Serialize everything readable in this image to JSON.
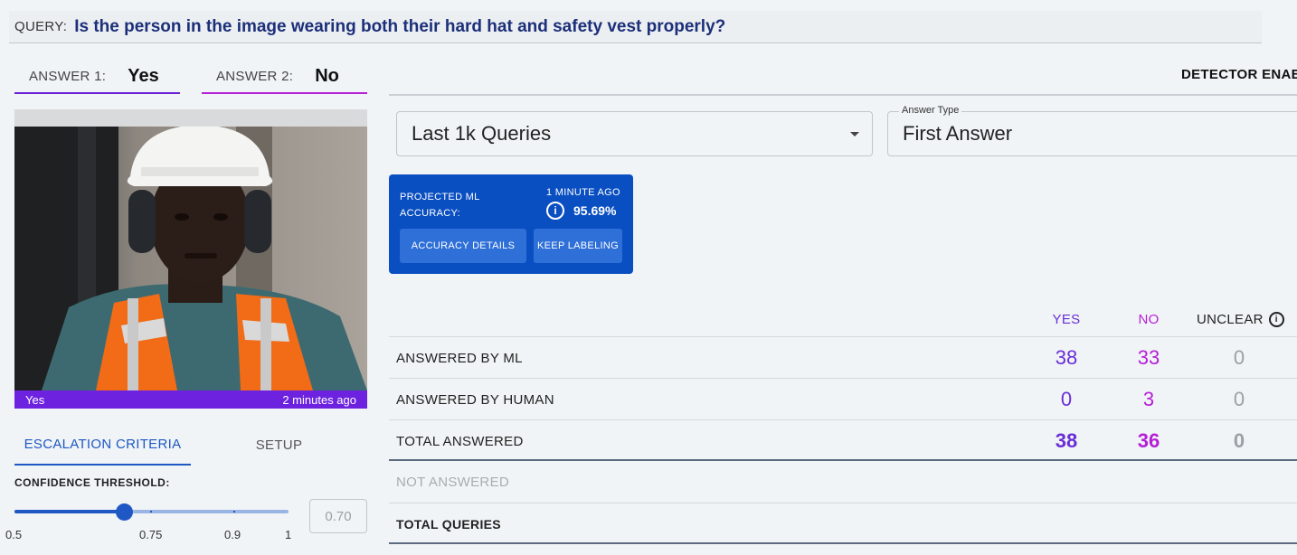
{
  "query": {
    "label": "QUERY:",
    "text": "Is the person in the image wearing both their hard hat and safety vest properly?"
  },
  "answers": [
    {
      "label": "ANSWER 1:",
      "value": "Yes",
      "color": "#6b21d6"
    },
    {
      "label": "ANSWER 2:",
      "value": "No",
      "color": "#b621d6"
    }
  ],
  "detector_label": "DETECTOR ENABL",
  "image": {
    "caption_left": "Yes",
    "caption_right": "2 minutes ago",
    "caption_color": "#6d22e0"
  },
  "escalation": {
    "tabs": [
      "ESCALATION CRITERIA",
      "SETUP"
    ],
    "confidence_label": "CONFIDENCE THRESHOLD:",
    "ticks": [
      "0.5",
      "0.75",
      "0.9",
      "1"
    ],
    "value": 0.7,
    "value_text": "0.70"
  },
  "filters": {
    "range": {
      "value": "Last 1k Queries"
    },
    "answer_type": {
      "label": "Answer Type",
      "value": "First Answer"
    }
  },
  "accuracy_card": {
    "title_line1": "PROJECTED ML",
    "title_line2": "ACCURACY:",
    "time": "1 MINUTE AGO",
    "value": "95.69%",
    "details_button": "ACCURACY DETAILS",
    "label_button": "KEEP LABELING",
    "color": "#0a4fc1"
  },
  "stats": {
    "headers": {
      "yes": "YES",
      "no": "NO",
      "unclear": "UNCLEAR"
    },
    "rows": [
      {
        "label": "ANSWERED BY ML",
        "yes": "38",
        "no": "33",
        "unclear": "0"
      },
      {
        "label": "ANSWERED BY HUMAN",
        "yes": "0",
        "no": "3",
        "unclear": "0"
      },
      {
        "label": "TOTAL ANSWERED",
        "yes": "38",
        "no": "36",
        "unclear": "0"
      },
      {
        "label": "NOT ANSWERED"
      },
      {
        "label": "TOTAL QUERIES"
      }
    ],
    "colors": {
      "yes": "#6a2ed6",
      "no": "#b51ed6",
      "unclear": "#9aa0a6"
    }
  }
}
